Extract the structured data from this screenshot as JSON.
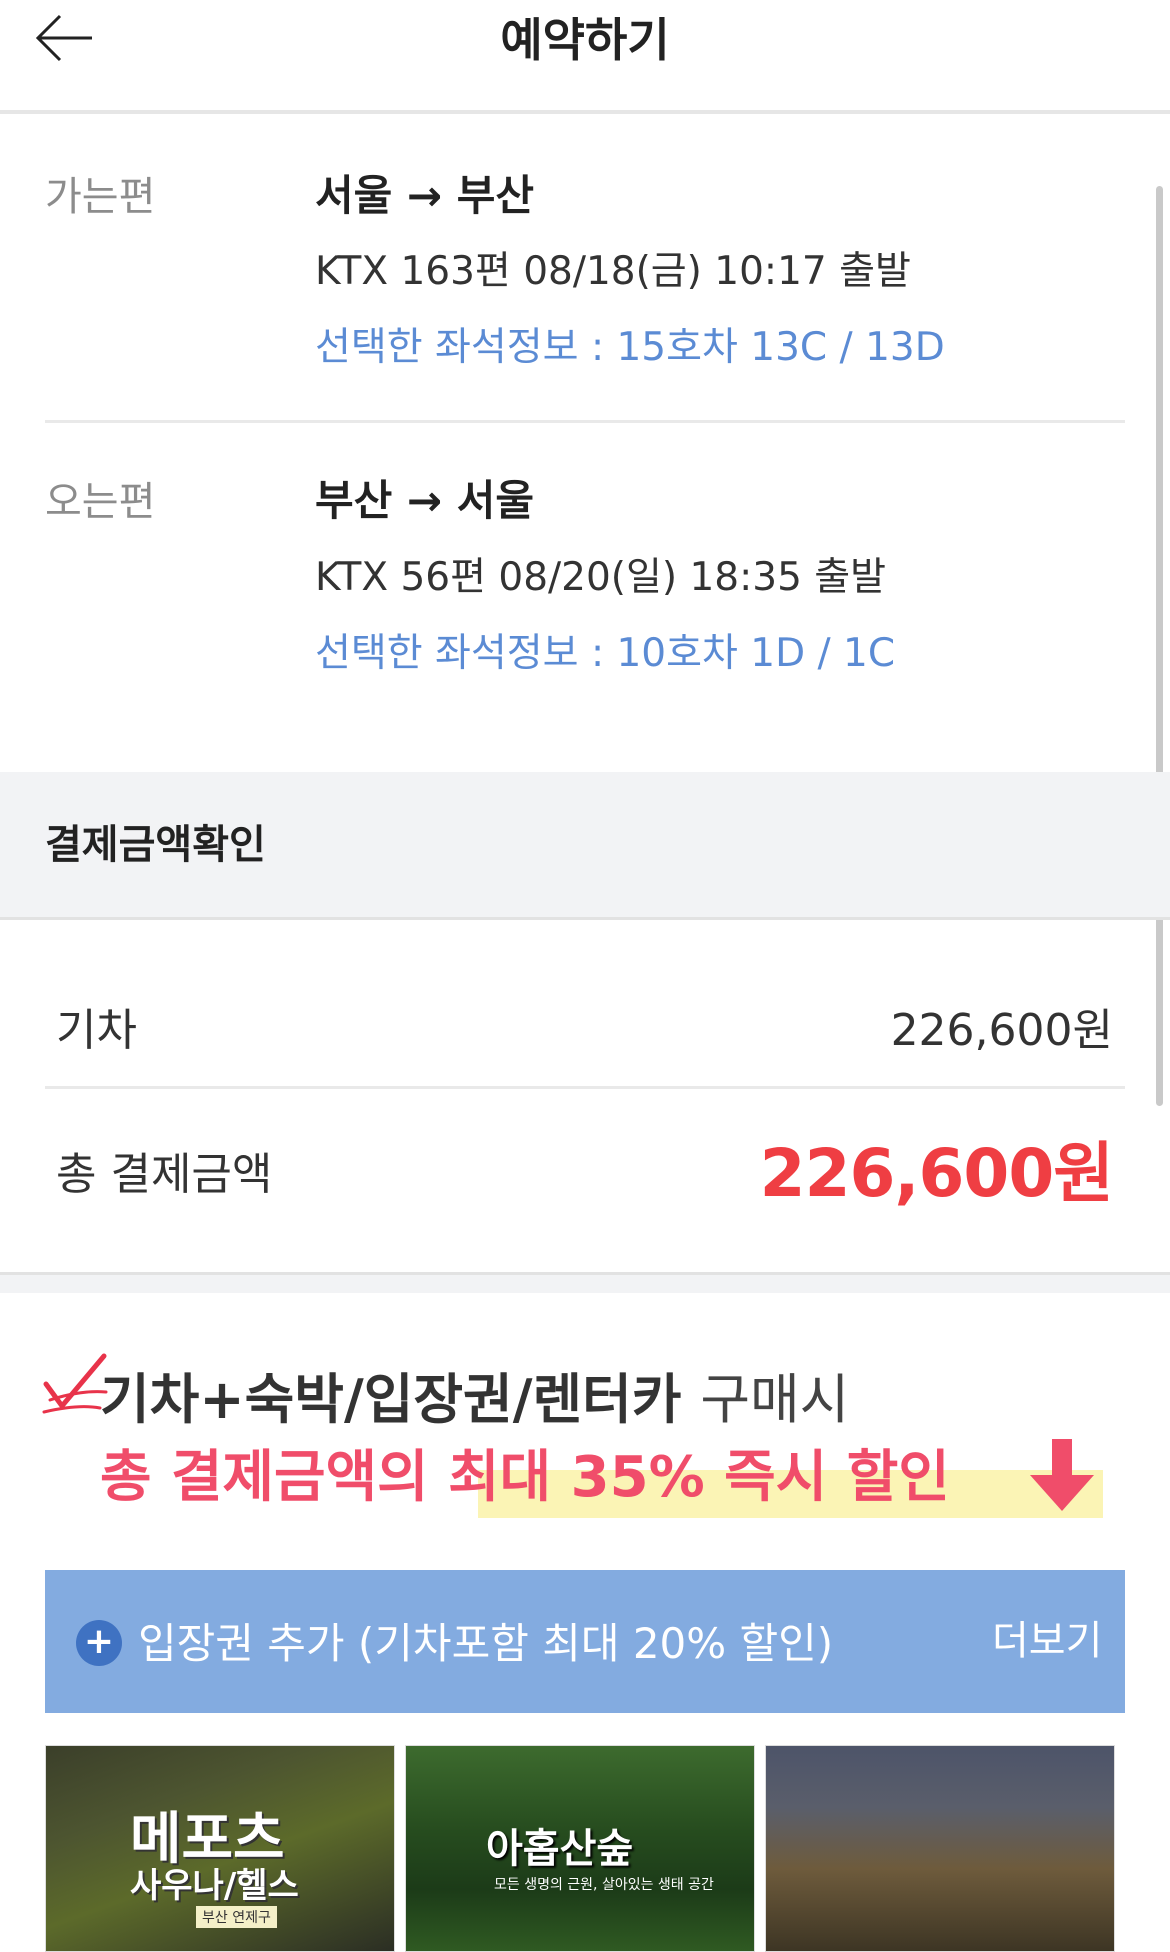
{
  "header": {
    "title": "예약하기",
    "back_icon": "arrow-left-icon"
  },
  "outbound": {
    "label": "가는편",
    "route": "서울 → 부산",
    "detail": "KTX 163편 08/18(금) 10:17 출발",
    "seat": "선택한 좌석정보 : 15호차 13C / 13D"
  },
  "inbound": {
    "label": "오는편",
    "route": "부산 → 서울",
    "detail": "KTX 56편 08/20(일) 18:35 출발",
    "seat": "선택한 좌석정보 : 10호차 1D / 1C"
  },
  "payment": {
    "header": "결제금액확인",
    "train_label": "기차",
    "train_value": "226,600원",
    "total_label": "총 결제금액",
    "total_value": "226,600원",
    "total_color": "#ef3e43"
  },
  "promo": {
    "line1_bold": "기차+숙박/입장권/렌터카",
    "line1_light": "구매시",
    "line2": "총 결제금액의 최대 35% 즉시 할인",
    "check_icon": "check-mark-icon",
    "arrow_icon": "arrow-down-icon",
    "accent_color": "#f04d6a"
  },
  "ticket_bar": {
    "plus_icon": "+",
    "text": "입장권 추가 (기차포함 최대 20% 할인)",
    "more": "더보기"
  },
  "thumbnails": [
    {
      "title": "메포츠",
      "subtitle": "사우나/헬스",
      "tag": "부산 연제구"
    },
    {
      "title": "아홉산숲",
      "subtitle": "모든 생명의 근원, 살아있는 생태 공간"
    },
    {
      "title": ""
    }
  ]
}
